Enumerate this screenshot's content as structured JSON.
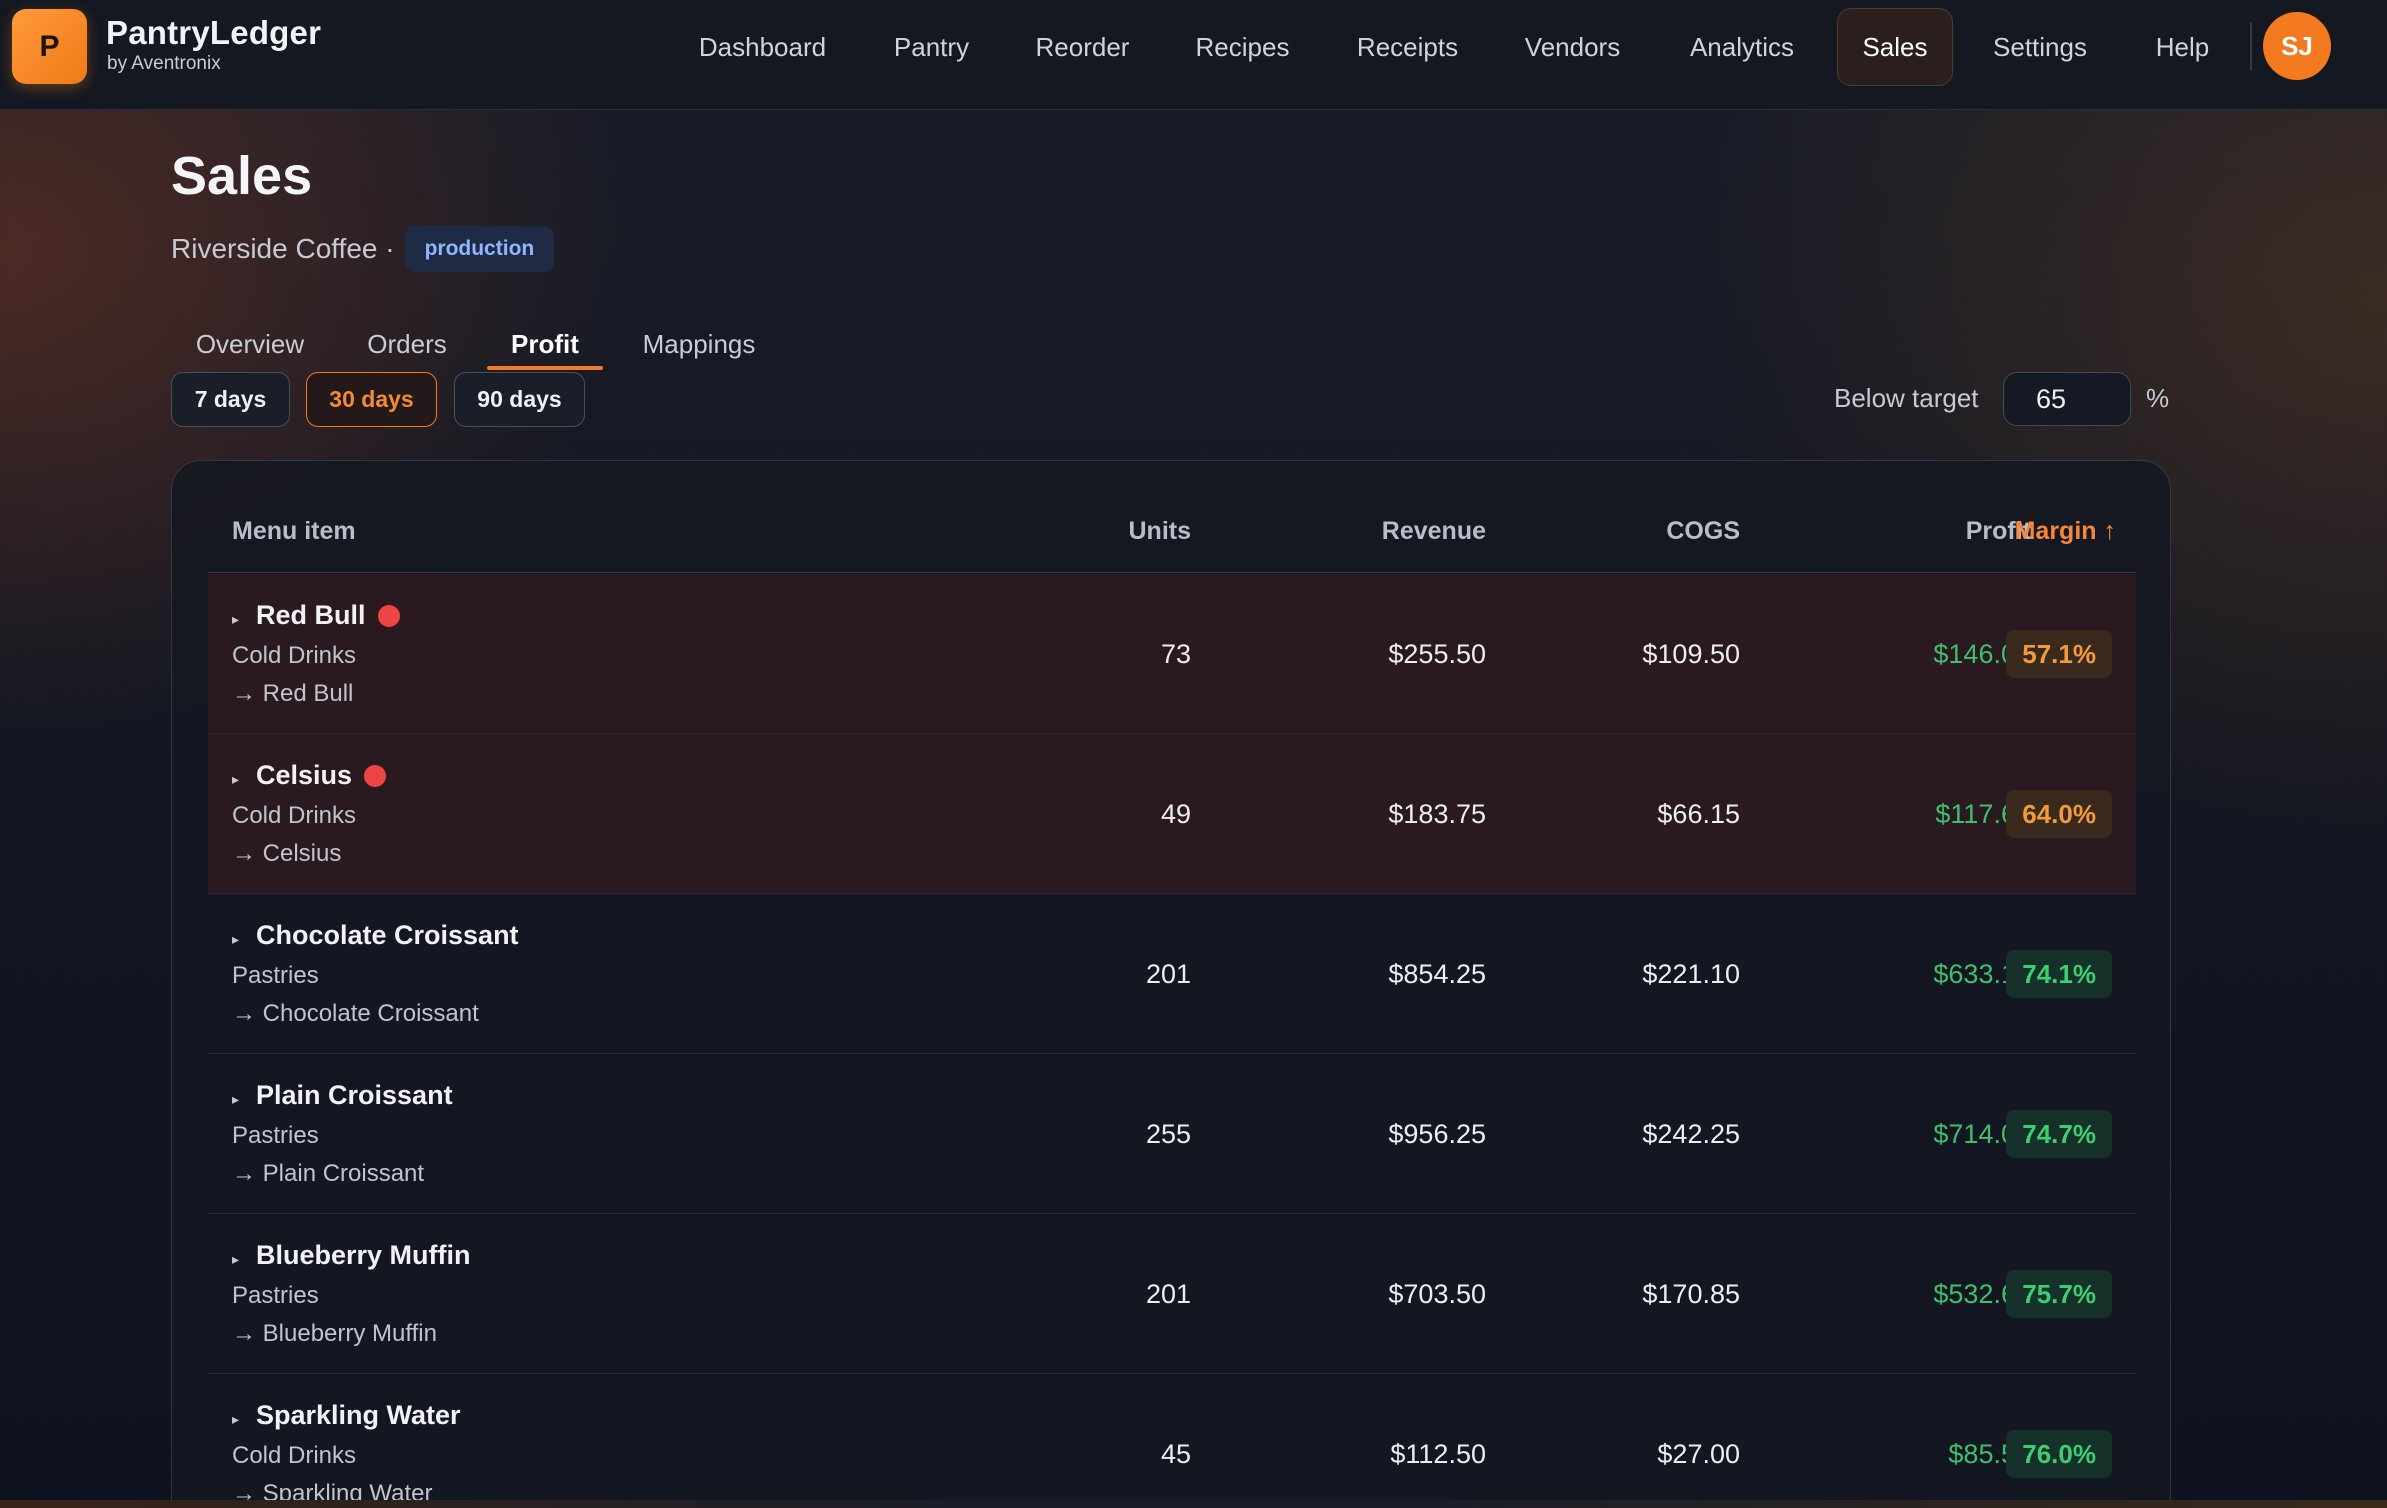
{
  "app": {
    "name": "PantryLedger",
    "vendor": "by Aventronix",
    "logo_letter": "P"
  },
  "nav": {
    "items": [
      {
        "label": "Dashboard"
      },
      {
        "label": "Pantry"
      },
      {
        "label": "Reorder"
      },
      {
        "label": "Recipes"
      },
      {
        "label": "Receipts"
      },
      {
        "label": "Vendors"
      },
      {
        "label": "Analytics"
      },
      {
        "label": "Sales",
        "active": true
      },
      {
        "label": "Settings"
      },
      {
        "label": "Help"
      }
    ],
    "avatar_initials": "SJ"
  },
  "page": {
    "title": "Sales",
    "location": "Riverside Coffee ·",
    "environment": "production"
  },
  "tabs": [
    {
      "label": "Overview"
    },
    {
      "label": "Orders"
    },
    {
      "label": "Profit",
      "active": true
    },
    {
      "label": "Mappings"
    }
  ],
  "ranges": [
    {
      "label": "7 days"
    },
    {
      "label": "30 days",
      "active": true
    },
    {
      "label": "90 days"
    }
  ],
  "target": {
    "label": "Below target",
    "value": "65",
    "unit": "%"
  },
  "table": {
    "columns": {
      "item": "Menu item",
      "units": "Units",
      "revenue": "Revenue",
      "cogs": "COGS",
      "profit": "Profit",
      "margin": "Margin ↑"
    },
    "rows": [
      {
        "name": "Red Bull",
        "flagged": true,
        "category": "Cold Drinks",
        "mapping": "→ Red Bull",
        "units": "73",
        "revenue": "$255.50",
        "cogs": "$109.50",
        "profit": "$146.00",
        "margin": "57.1%",
        "status": "warn"
      },
      {
        "name": "Celsius",
        "flagged": true,
        "category": "Cold Drinks",
        "mapping": "→ Celsius",
        "units": "49",
        "revenue": "$183.75",
        "cogs": "$66.15",
        "profit": "$117.60",
        "margin": "64.0%",
        "status": "warn"
      },
      {
        "name": "Chocolate Croissant",
        "flagged": false,
        "category": "Pastries",
        "mapping": "→ Chocolate Croissant",
        "units": "201",
        "revenue": "$854.25",
        "cogs": "$221.10",
        "profit": "$633.15",
        "margin": "74.1%",
        "status": "good"
      },
      {
        "name": "Plain Croissant",
        "flagged": false,
        "category": "Pastries",
        "mapping": "→ Plain Croissant",
        "units": "255",
        "revenue": "$956.25",
        "cogs": "$242.25",
        "profit": "$714.00",
        "margin": "74.7%",
        "status": "good"
      },
      {
        "name": "Blueberry Muffin",
        "flagged": false,
        "category": "Pastries",
        "mapping": "→ Blueberry Muffin",
        "units": "201",
        "revenue": "$703.50",
        "cogs": "$170.85",
        "profit": "$532.65",
        "margin": "75.7%",
        "status": "good"
      },
      {
        "name": "Sparkling Water",
        "flagged": false,
        "category": "Cold Drinks",
        "mapping": "→ Sparkling Water",
        "units": "45",
        "revenue": "$112.50",
        "cogs": "$27.00",
        "profit": "$85.50",
        "margin": "76.0%",
        "status": "good"
      }
    ]
  },
  "colors": {
    "accent": "#f47a20",
    "profit": "#3fbf6a",
    "flag_dot": "#ef4444",
    "margin_warn": "#f39a3a",
    "margin_good": "#3ccf6e"
  }
}
